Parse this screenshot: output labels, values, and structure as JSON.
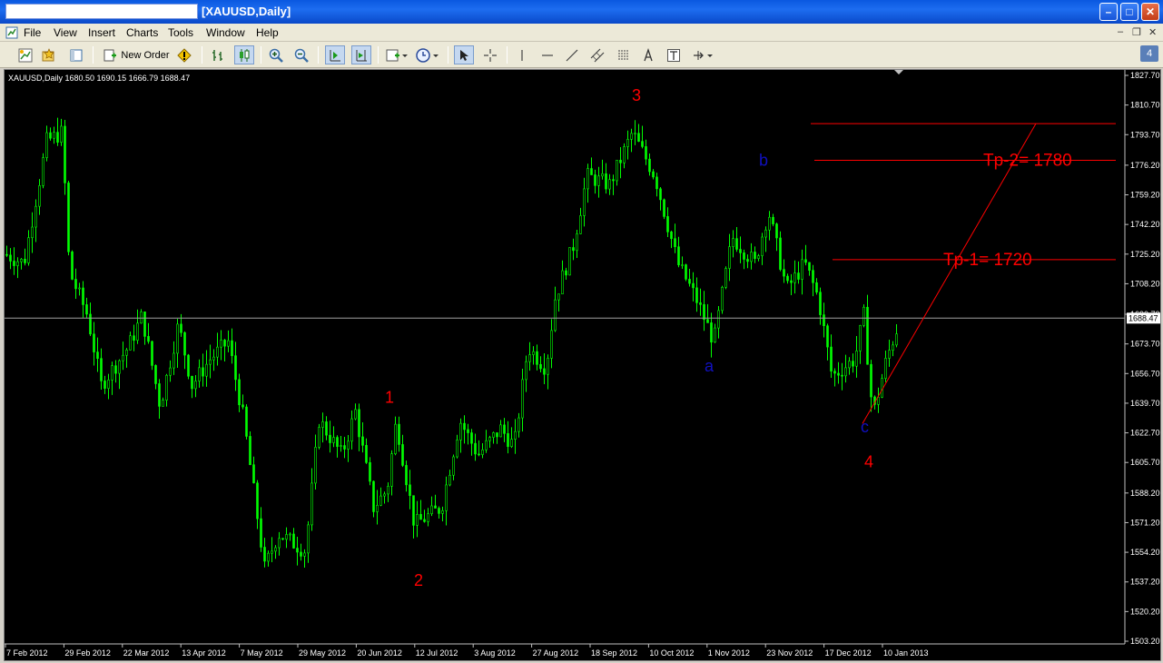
{
  "window": {
    "title": "[XAUUSD,Daily]",
    "minimize": "–",
    "maximize": "□",
    "close": "✕"
  },
  "menu": {
    "items": [
      "File",
      "View",
      "Insert",
      "Charts",
      "Tools",
      "Window",
      "Help"
    ],
    "mdi_min": "–",
    "mdi_restore": "❐",
    "mdi_close": "✕"
  },
  "toolbar": {
    "new_order_label": "New Order",
    "badge": "4",
    "icons": [
      "new-chart-icon",
      "profiles-icon",
      "navigator-icon",
      "new-order-icon",
      "expert-advisors-icon",
      "bar-chart-icon",
      "candlestick-icon",
      "zoom-in-icon",
      "zoom-out-icon",
      "chart-shift-icon",
      "autoscroll-icon",
      "indicators-icon",
      "periods-icon",
      "cursor-icon",
      "crosshair-icon",
      "vertical-line-icon",
      "horizontal-line-icon",
      "trendline-icon",
      "equidistant-channel-icon",
      "fibonacci-icon",
      "text-icon",
      "text-label-icon",
      "arrows-icon"
    ]
  },
  "chart_data": {
    "type": "candlestick",
    "symbol_info": "XAUUSD,Daily  1680.50 1690.15 1666.79 1688.47",
    "price_levels": [
      "1827.70",
      "1810.70",
      "1793.70",
      "1776.20",
      "1759.20",
      "1742.20",
      "1725.20",
      "1708.20",
      "1690.70",
      "1673.70",
      "1656.70",
      "1639.70",
      "1622.70",
      "1605.70",
      "1588.20",
      "1571.20",
      "1554.20",
      "1537.20",
      "1520.20",
      "1503.20"
    ],
    "current_price": "1688.47",
    "dates": [
      "7 Feb 2012",
      "29 Feb 2012",
      "22 Mar 2012",
      "13 Apr 2012",
      "7 May 2012",
      "29 May 2012",
      "20 Jun 2012",
      "12 Jul 2012",
      "3 Aug 2012",
      "27 Aug 2012",
      "18 Sep 2012",
      "10 Oct 2012",
      "1 Nov 2012",
      "23 Nov 2012",
      "17 Dec 2012",
      "10 Jan 2013"
    ],
    "candle_color": "#00ff00",
    "background": "#000000",
    "wave_labels": [
      {
        "text": "1",
        "color": "#ff0000",
        "date": "20 Jun 2012",
        "price": 1640
      },
      {
        "text": "2",
        "color": "#ff0000",
        "date": "12 Jul 2012",
        "price": 1535
      },
      {
        "text": "3",
        "color": "#ff0000",
        "date": "18 Sep 2012",
        "price": 1813
      },
      {
        "text": "4",
        "color": "#ff0000",
        "date": "17 Dec 2012",
        "price": 1603
      },
      {
        "text": "a",
        "color": "#1010c0",
        "date": "1 Nov 2012",
        "price": 1658
      },
      {
        "text": "b",
        "color": "#1010c0",
        "date": "23 Nov 2012",
        "price": 1776
      },
      {
        "text": "c",
        "color": "#1010c0",
        "date": "17 Dec 2012",
        "price": 1623
      }
    ],
    "annotations": [
      {
        "text": "Tp-1= 1720",
        "color": "#ff0000",
        "price": 1722
      },
      {
        "text": "Tp-2= 1780",
        "color": "#ff0000",
        "price": 1779
      }
    ],
    "horizontal_lines": [
      1800,
      1779,
      1722
    ],
    "trendline": {
      "from_price": 1628,
      "to_price": 1800
    }
  }
}
